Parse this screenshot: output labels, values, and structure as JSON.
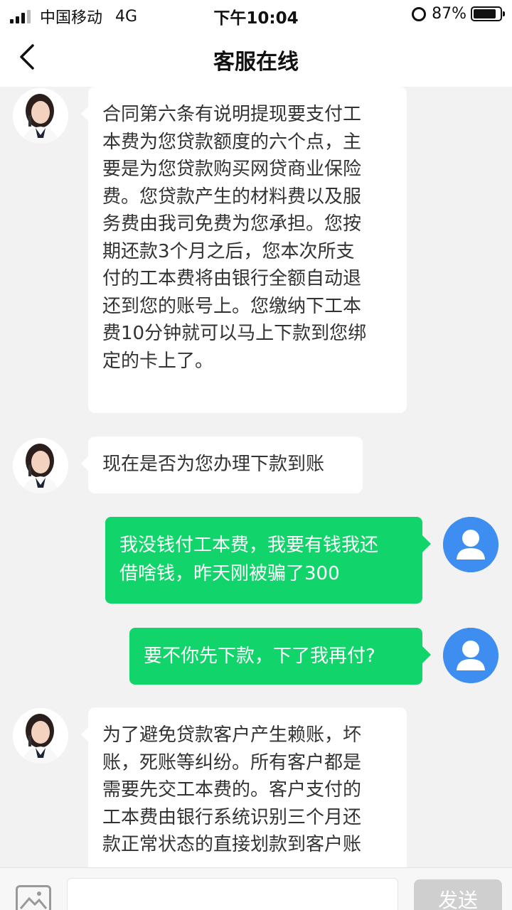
{
  "status_bar": {
    "carrier": "中国移动",
    "network": "4G",
    "time": "下午10:04",
    "battery": "87%",
    "battery_level": 0.87
  },
  "nav": {
    "title": "客服在线",
    "back_icon": "chevron-left-icon"
  },
  "messages": [
    {
      "sender": "agent",
      "lines": [
        "合同第六条有说明提现要支付工",
        "本费为您贷款额度的六个点，主",
        "要是为您贷款购买网贷商业保险",
        "费。您贷款产生的材料费以及服",
        "务费由我司免费为您承担。您按",
        "期还款3个月之后，您本次所支",
        "付的工本费将由银行全额自动退",
        "还到您的账号上。您缴纳下工本",
        "费10分钟就可以马上下款到您绑",
        "定的卡上了。"
      ]
    },
    {
      "sender": "agent",
      "lines": [
        "现在是否为您办理下款到账"
      ]
    },
    {
      "sender": "user",
      "lines": [
        "我没钱付工本费，我要有钱我还",
        "借啥钱，昨天刚被骗了300"
      ]
    },
    {
      "sender": "user",
      "lines": [
        "要不你先下款，下了我再付?"
      ]
    },
    {
      "sender": "agent",
      "lines": [
        "为了避免贷款客户产生赖账，坏",
        "账，死账等纠纷。所有客户都是",
        "需要先交工本费的。客户支付的",
        "工本费由银行系统识别三个月还",
        "款正常状态的直接划款到客户账"
      ]
    }
  ],
  "input_bar": {
    "placeholder": "",
    "send_label": "发送"
  },
  "colors": {
    "user_bubble": "#11d56a",
    "agent_bubble": "#ffffff",
    "background": "#f2f2f2",
    "user_avatar": "#3d8ef0"
  }
}
